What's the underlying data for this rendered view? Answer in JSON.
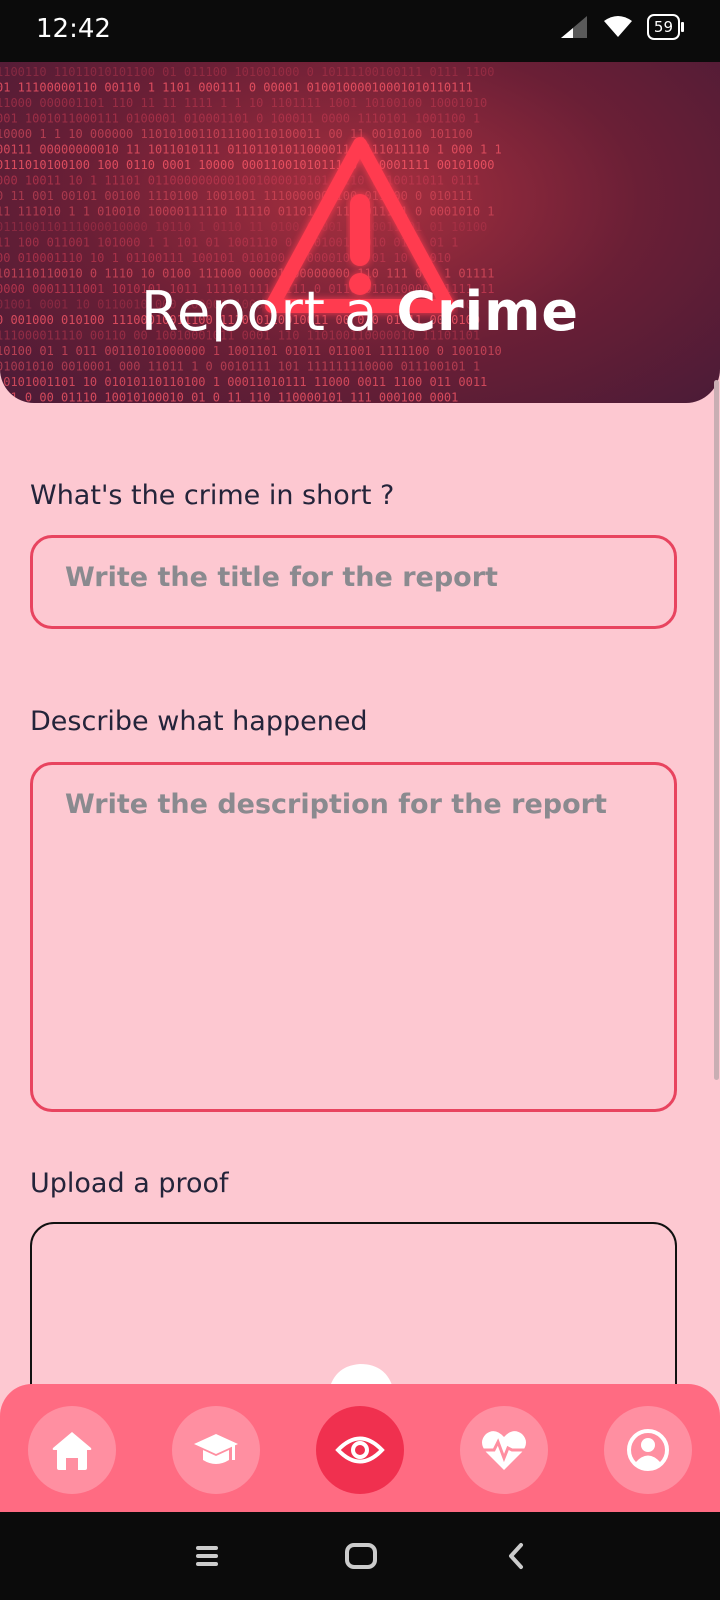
{
  "status_bar": {
    "time": "12:42",
    "battery": "59"
  },
  "header": {
    "title_prefix": "Report  a ",
    "title_bold": "Crime"
  },
  "form": {
    "title_label": "What's the crime in short ?",
    "title_placeholder": "Write the title for the report",
    "description_label": "Describe what happened",
    "description_placeholder": "Write the description for the report",
    "upload_label": "Upload a proof"
  },
  "bottom_nav": {
    "items": [
      {
        "icon": "home-icon",
        "active": false
      },
      {
        "icon": "graduation-cap-icon",
        "active": false
      },
      {
        "icon": "eye-icon",
        "active": true
      },
      {
        "icon": "heart-pulse-icon",
        "active": false
      },
      {
        "icon": "profile-icon",
        "active": false
      }
    ]
  },
  "colors": {
    "accent": "#e8445f",
    "background": "#fdc8d1",
    "nav": "#ff6b82",
    "nav_active": "#f0304f"
  }
}
